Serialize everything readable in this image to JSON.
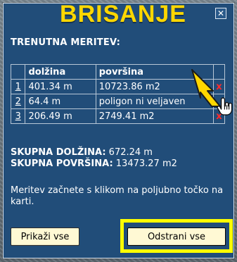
{
  "header": {
    "title": "BRISANJE",
    "subtitle": "TRENUTNA MERITEV:",
    "close_glyph": "✕"
  },
  "table": {
    "columns": [
      "",
      "dolžina",
      "površina",
      ""
    ],
    "rows": [
      {
        "index": "1",
        "length": "401.34 m",
        "area": "10723.86 m2",
        "delete": "x"
      },
      {
        "index": "2",
        "length": "64.4 m",
        "area": "poligon ni veljaven",
        "delete": ""
      },
      {
        "index": "3",
        "length": "206.49 m",
        "area": "2749.41 m2",
        "delete": "x"
      }
    ]
  },
  "totals": {
    "total_length_label": "SKUPNA DOLŽINA:",
    "total_length_value": "672.24 m",
    "total_area_label": "SKUPNA POVRŠINA:",
    "total_area_value": "13473.27 m2"
  },
  "help": {
    "text": "Meritev začnete s klikom na poljubno točko na karti."
  },
  "buttons": {
    "show_all": "Prikaži vse",
    "remove_all": "Odstrani vse"
  },
  "colors": {
    "panel_bg": "#214d79",
    "title_yellow": "#ffd700",
    "highlight_yellow": "#ffff00",
    "delete_red": "#ff2a2a",
    "button_bg": "#fff9d4"
  },
  "icons": {
    "close": "close-icon",
    "arrow": "arrow-pointer-icon",
    "cursor": "hand-cursor-icon",
    "delete": "delete-x-icon"
  }
}
